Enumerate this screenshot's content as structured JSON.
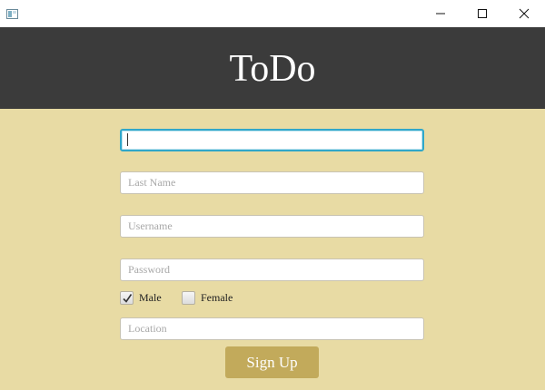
{
  "titlebar": {
    "icons": [
      "app-icon",
      "minimize-icon",
      "maximize-icon",
      "close-icon"
    ]
  },
  "header": {
    "title": "ToDo",
    "background": "#3b3b3b"
  },
  "form": {
    "first_name": {
      "value": "",
      "placeholder": ""
    },
    "last_name": {
      "value": "",
      "placeholder": "Last Name"
    },
    "username": {
      "value": "",
      "placeholder": "Username"
    },
    "password": {
      "value": "",
      "placeholder": "Password"
    },
    "gender": {
      "male": {
        "label": "Male",
        "checked": true
      },
      "female": {
        "label": "Female",
        "checked": false
      }
    },
    "location": {
      "value": "",
      "placeholder": "Location"
    },
    "signup_label": "Sign Up"
  },
  "colors": {
    "background": "#e8dba4",
    "accent": "#c2aa5b",
    "focus": "#30a7c9"
  }
}
